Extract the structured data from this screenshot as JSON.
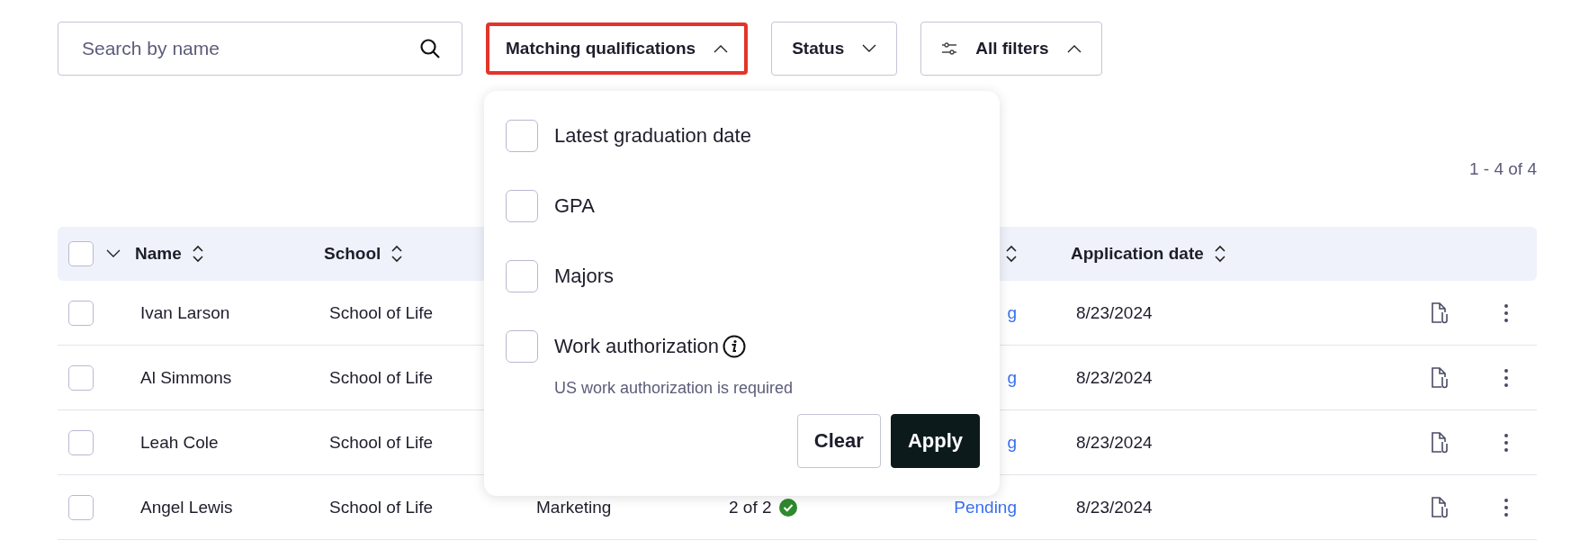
{
  "search": {
    "placeholder": "Search by name"
  },
  "filters": [
    {
      "label": "Matching qualifications",
      "kind": "plain",
      "expanded": true,
      "highlighted": true
    },
    {
      "label": "Status",
      "kind": "plain",
      "expanded": false,
      "highlighted": false
    },
    {
      "label": "All filters",
      "kind": "sliders",
      "expanded": true,
      "highlighted": false
    }
  ],
  "dropdown": {
    "options": [
      {
        "label": "Latest graduation date",
        "checked": false,
        "info": false
      },
      {
        "label": "GPA",
        "checked": false,
        "info": false
      },
      {
        "label": "Majors",
        "checked": false,
        "info": false
      },
      {
        "label": "Work authorization",
        "checked": false,
        "info": true,
        "note": "US work authorization is required"
      }
    ],
    "buttons": [
      {
        "label": "Clear",
        "kind": "secondary"
      },
      {
        "label": "Apply",
        "kind": "primary"
      }
    ]
  },
  "pagination": "1 - 4 of 4",
  "table": {
    "select_all": {
      "checked": false
    },
    "columns": [
      {
        "label": "Name",
        "sortable": true
      },
      {
        "label": "School",
        "sortable": true
      },
      {
        "sortable": true
      },
      {
        "label": "Application date",
        "sortable": true
      }
    ],
    "rows": [
      {
        "checked": false,
        "name": "Ivan Larson",
        "school": "School of Life",
        "column_5": "g",
        "application_date": "8/23/2024"
      },
      {
        "checked": false,
        "name": "Al Simmons",
        "school": "School of Life",
        "column_5": "g",
        "application_date": "8/23/2024"
      },
      {
        "checked": false,
        "name": "Leah Cole",
        "school": "School of Life",
        "column_5": "g",
        "application_date": "8/23/2024"
      },
      {
        "checked": false,
        "name": "Angel Lewis",
        "school": "School of Life",
        "column_3": "Marketing",
        "column_4": "2 of 2",
        "matched": true,
        "column_5": "Pending",
        "application_date": "8/23/2024"
      }
    ]
  }
}
